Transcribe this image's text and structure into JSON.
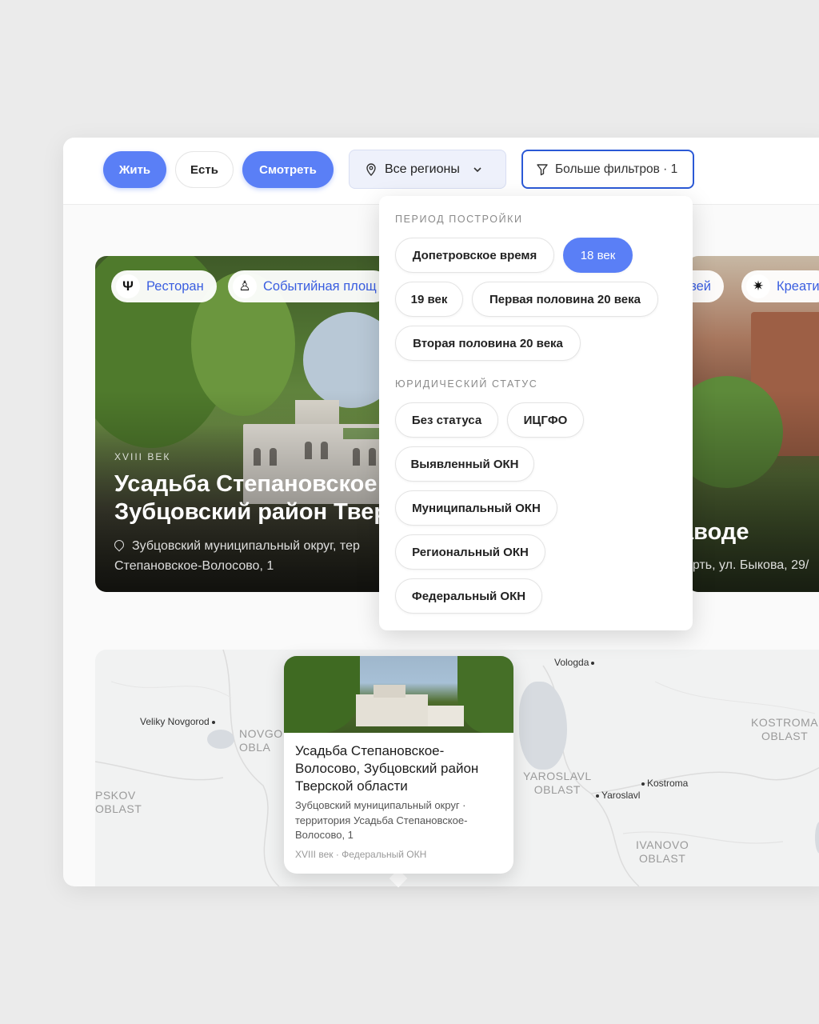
{
  "toolbar": {
    "tabs": [
      {
        "label": "Жить",
        "active": true
      },
      {
        "label": "Есть",
        "active": false
      },
      {
        "label": "Смотреть",
        "active": true
      }
    ],
    "region_select": "Все регионы",
    "more_filters": "Больше фильтров · 1"
  },
  "cards": {
    "left": {
      "tags": [
        "Ресторан",
        "Событийная площ"
      ],
      "century": "XVIII ВЕК",
      "title": "Усадьба Степановское\nЗубцовский район Твер",
      "address": "Зубцовский муниципальный округ, тер\nСтепановское-Волосово, 1"
    },
    "right": {
      "tags": [
        "узей",
        "Креати"
      ],
      "title": "аводе",
      "address": "ерть, ул. Быкова, 29/"
    }
  },
  "filters_dropdown": {
    "period_title": "ПЕРИОД ПОСТРОЙКИ",
    "period_options": [
      {
        "label": "Допетровское время",
        "selected": false
      },
      {
        "label": "18 век",
        "selected": true
      },
      {
        "label": "19 век",
        "selected": false
      },
      {
        "label": "Первая половина 20 века",
        "selected": false
      },
      {
        "label": "Вторая половина 20 века",
        "selected": false
      }
    ],
    "status_title": "ЮРИДИЧЕСКИЙ СТАТУС",
    "status_options": [
      {
        "label": "Без статуса",
        "selected": false
      },
      {
        "label": "ИЦГФО",
        "selected": false
      },
      {
        "label": "Выявленный ОКН",
        "selected": false
      },
      {
        "label": "Муниципальный ОКН",
        "selected": false
      },
      {
        "label": "Региональный ОКН",
        "selected": false
      },
      {
        "label": "Федеральный ОКН",
        "selected": false
      }
    ]
  },
  "map": {
    "cities": [
      "Vologda",
      "Veliky Novgorod",
      "Kostroma",
      "Yaroslavl"
    ],
    "regions": [
      "NOVGO\nOBLA",
      "KOSTROMA\nOBLAST",
      "YAROSLAVL\nOBLAST",
      "PSKOV\nOBLAST",
      "IVANOVO\nOBLAST"
    ],
    "popup": {
      "title": "Усадьба Степановское-Волосово, Зубцовский район Тверской области",
      "address": "Зубцовский муниципальный округ · территория Усадьба Степановское-Волосово, 1",
      "meta": "XVIII век · Федеральный ОКН"
    }
  },
  "colors": {
    "accent": "#5a7ff6",
    "focus_border": "#2b59d6"
  },
  "icons": [
    "location-pin-icon",
    "chevron-down-icon",
    "filter-funnel-icon",
    "fork-knife-icon",
    "stage-icon",
    "sparkle-icon"
  ]
}
